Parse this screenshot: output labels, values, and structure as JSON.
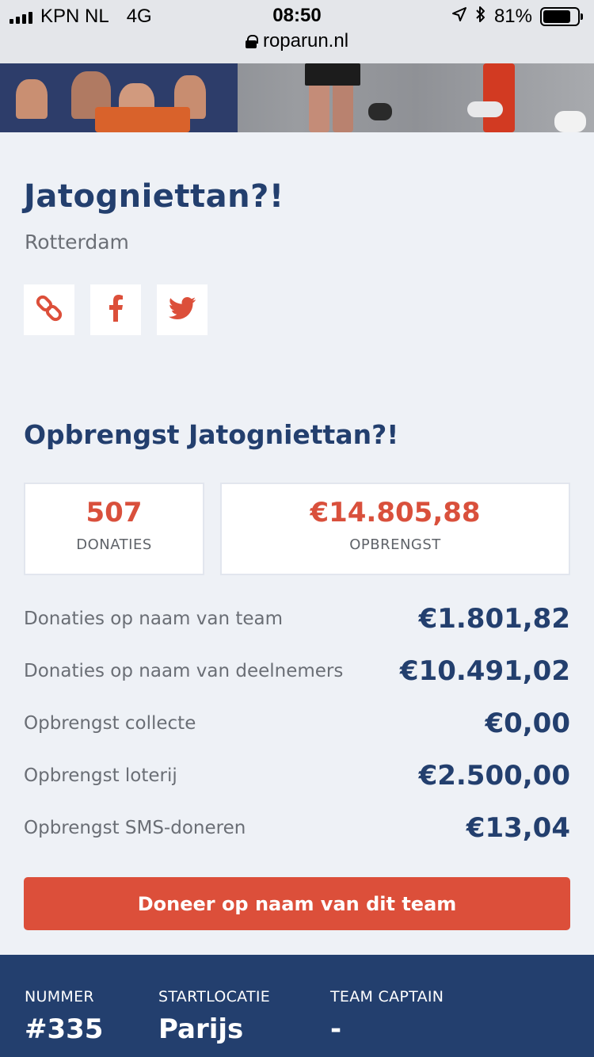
{
  "status_bar": {
    "carrier": "KPN NL",
    "network": "4G",
    "time": "08:50",
    "battery": "81%",
    "battery_level": 0.81,
    "url": "roparun.nl"
  },
  "team": {
    "name": "Jatogniettan?!",
    "city": "Rotterdam",
    "share_icons": [
      "link-icon",
      "facebook-icon",
      "twitter-icon"
    ]
  },
  "revenue": {
    "title": "Opbrengst Jatogniettan?!",
    "donations_count": "507",
    "donations_label": "DONATIES",
    "total": "€14.805,88",
    "total_label": "OPBRENGST",
    "rows": [
      {
        "label": "Donaties op naam van team",
        "value": "€1.801,82"
      },
      {
        "label": "Donaties op naam van deelnemers",
        "value": "€10.491,02"
      },
      {
        "label": "Opbrengst collecte",
        "value": "€0,00"
      },
      {
        "label": "Opbrengst loterij",
        "value": "€2.500,00"
      },
      {
        "label": "Opbrengst SMS-doneren",
        "value": "€13,04"
      }
    ],
    "donate_button": "Doneer op naam van dit team"
  },
  "footer": {
    "number_label": "NUMMER",
    "number_value": "#335",
    "start_label": "STARTLOCATIE",
    "start_value": "Parijs",
    "captain_label": "TEAM CAPTAIN",
    "captain_value": "-"
  },
  "colors": {
    "navy": "#233f6e",
    "accent_red": "#dc4f3a",
    "background": "#eef1f6"
  }
}
